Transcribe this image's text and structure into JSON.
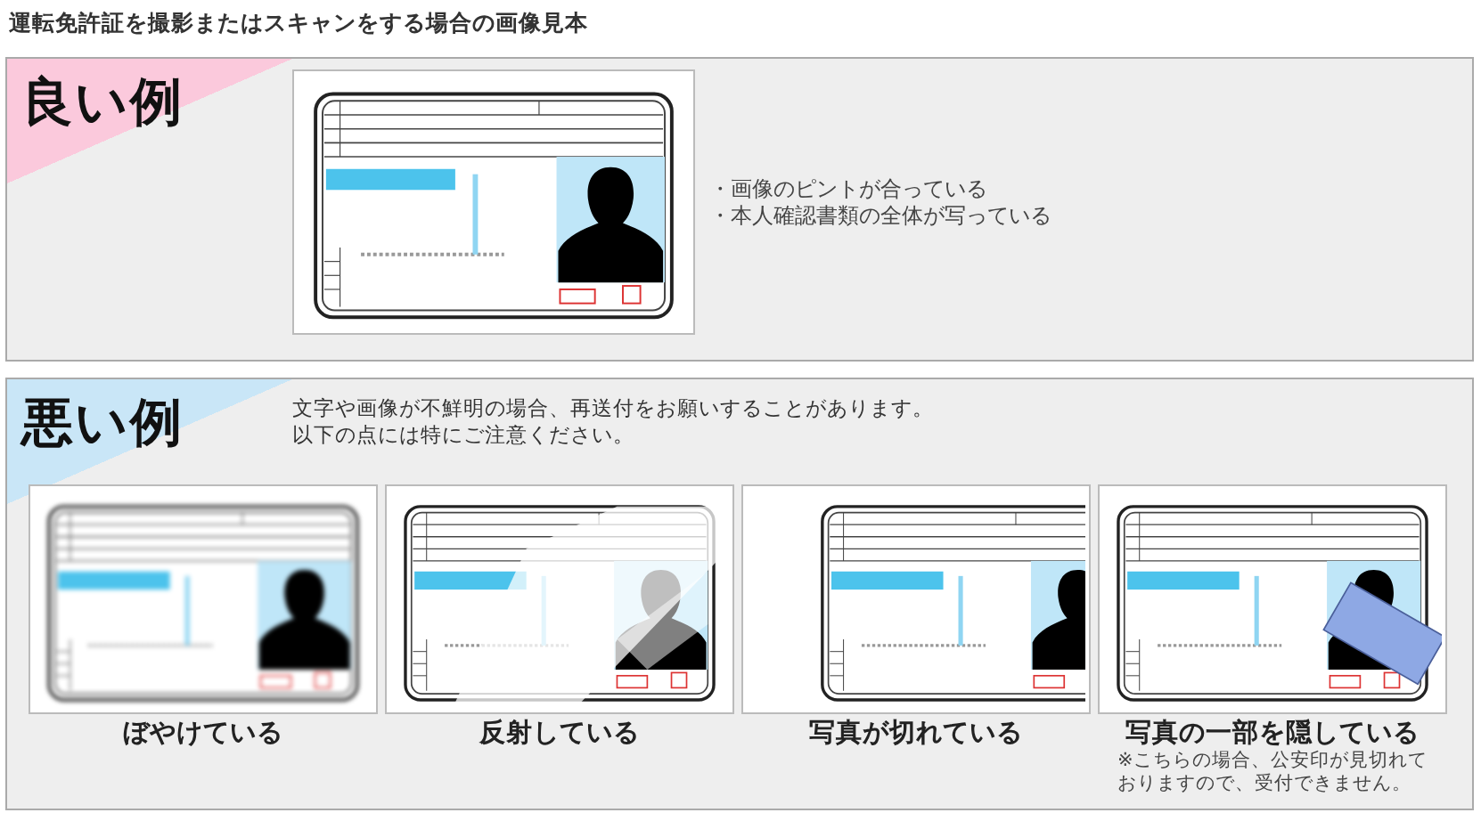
{
  "page_title": "運転免許証を撮影またはスキャンをする場合の画像見本",
  "good": {
    "label": "良い例",
    "points": [
      "・画像のピントが合っている",
      "・本人確認書類の全体が写っている"
    ]
  },
  "bad": {
    "label": "悪い例",
    "notice": [
      "文字や画像が不鮮明の場合、再送付をお願いすることがあります。",
      "以下の点には特にご注意ください。"
    ],
    "examples": [
      {
        "kind": "blurry",
        "caption": "ぼやけている"
      },
      {
        "kind": "glare",
        "caption": "反射している"
      },
      {
        "kind": "cropped",
        "caption": "写真が切れている"
      },
      {
        "kind": "covered",
        "caption": "写真の一部を隠している",
        "note": "※こちらの場合、公安印が見切れておりますので、受付できません。"
      }
    ]
  }
}
